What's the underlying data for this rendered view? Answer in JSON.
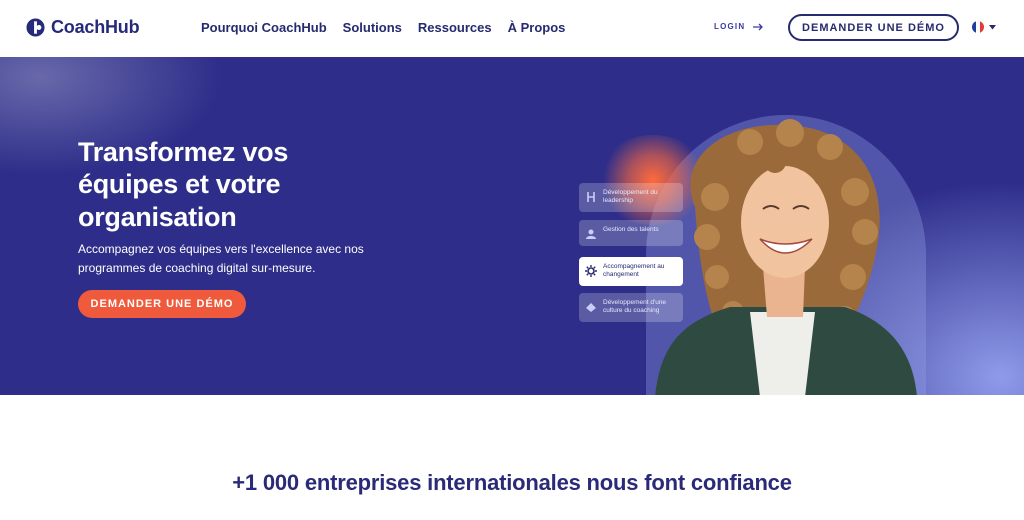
{
  "header": {
    "logo_text": "CoachHub",
    "nav": [
      "Pourquoi CoachHub",
      "Solutions",
      "Ressources",
      "À Propos"
    ],
    "login_label": "LOGIN",
    "demo_button": "DEMANDER UNE DÉMO",
    "language_icon": "flag-fr-icon"
  },
  "hero": {
    "title": "Transformez vos équipes et votre organisation",
    "subtitle": "Accompagnez vos équipes vers l'excellence avec nos programmes de coaching digital sur-mesure.",
    "cta": "DEMANDER UNE DÉMO",
    "cards": [
      {
        "label": "Développement du leadership",
        "icon": "leadership-icon"
      },
      {
        "label": "Gestion des talents",
        "icon": "talent-icon"
      },
      {
        "label": "Accompagnement au changement",
        "icon": "change-icon"
      },
      {
        "label": "Développement d'une culture du coaching",
        "icon": "culture-icon"
      }
    ]
  },
  "trust": {
    "heading": "+1 000 entreprises internationales nous font confiance"
  },
  "colors": {
    "navy": "#262a6e",
    "hero_bg": "#2e2e8a",
    "accent": "#ef5a3c"
  }
}
